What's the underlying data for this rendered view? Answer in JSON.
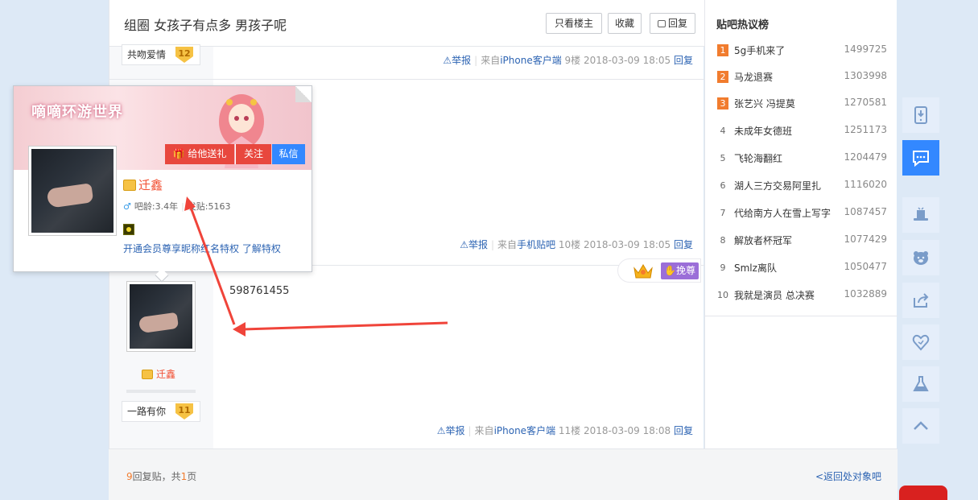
{
  "thread": {
    "title": "组圈 女孩子有点多 男孩子呢",
    "buttons": {
      "only_op": "只看楼主",
      "favorite": "收藏",
      "reply": "回复"
    }
  },
  "posts": [
    {
      "level_name": "共吻爱情",
      "level": "12",
      "report": "举报",
      "source_prefix": "来自",
      "source": "iPhone客户端",
      "floor": "9楼",
      "time": "2018-03-09 18:05",
      "reply": "回复"
    },
    {
      "report": "举报",
      "source_prefix": "来自",
      "source": "手机贴吧",
      "floor": "10楼",
      "time": "2018-03-09 18:05",
      "reply": "回复"
    },
    {
      "username": "迁鑫",
      "level_name": "一路有你",
      "level": "11",
      "content": "598761455",
      "report": "举报",
      "source_prefix": "来自",
      "source": "iPhone客户端",
      "floor": "11楼",
      "time": "2018-03-09 18:08",
      "reply": "回复"
    }
  ],
  "crown_tag": {
    "label": "挽尊"
  },
  "user_card": {
    "name": "迁鑫",
    "meta_age": "吧龄:3.4年",
    "meta_posts": "发贴:5163",
    "gender_symbol": "♂",
    "vip_text": "开通会员尊享昵称红名特权",
    "vip_link": "了解特权",
    "gift_btn": "给他送礼",
    "follow_btn": "关注",
    "msg_btn": "私信",
    "banner_text": "嘀嘀环游世界"
  },
  "sidebar": {
    "title": "贴吧热议榜",
    "items": [
      {
        "rank": "1",
        "name": "5g手机来了",
        "count": "1499725"
      },
      {
        "rank": "2",
        "name": "马龙退赛",
        "count": "1303998"
      },
      {
        "rank": "3",
        "name": "张艺兴 冯提莫",
        "count": "1270581"
      },
      {
        "rank": "4",
        "name": "未成年女德班",
        "count": "1251173"
      },
      {
        "rank": "5",
        "name": "飞轮海翻红",
        "count": "1204479"
      },
      {
        "rank": "6",
        "name": "湖人三方交易阿里扎",
        "count": "1116020"
      },
      {
        "rank": "7",
        "name": "代给南方人在雪上写字",
        "count": "1087457"
      },
      {
        "rank": "8",
        "name": "解放者杯冠军",
        "count": "1077429"
      },
      {
        "rank": "9",
        "name": "Smlz离队",
        "count": "1050477"
      },
      {
        "rank": "10",
        "name": "我就是演员 总决赛",
        "count": "1032889"
      }
    ]
  },
  "footer": {
    "reply_count": "9",
    "reply_label": "回复贴，共",
    "pages": "1",
    "pages_suffix": "页",
    "back": "<返回处对象吧"
  },
  "rail_icons": [
    "phone-download-icon",
    "message-icon",
    "magic-hat-icon",
    "bear-icon",
    "share-icon",
    "heart-icon",
    "flask-icon",
    "back-to-top-icon"
  ],
  "colors": {
    "accent": "#3388ff",
    "red": "#e8473e",
    "link": "#2d64b3",
    "orange": "#f17c2e",
    "purple": "#9b6ed8"
  }
}
